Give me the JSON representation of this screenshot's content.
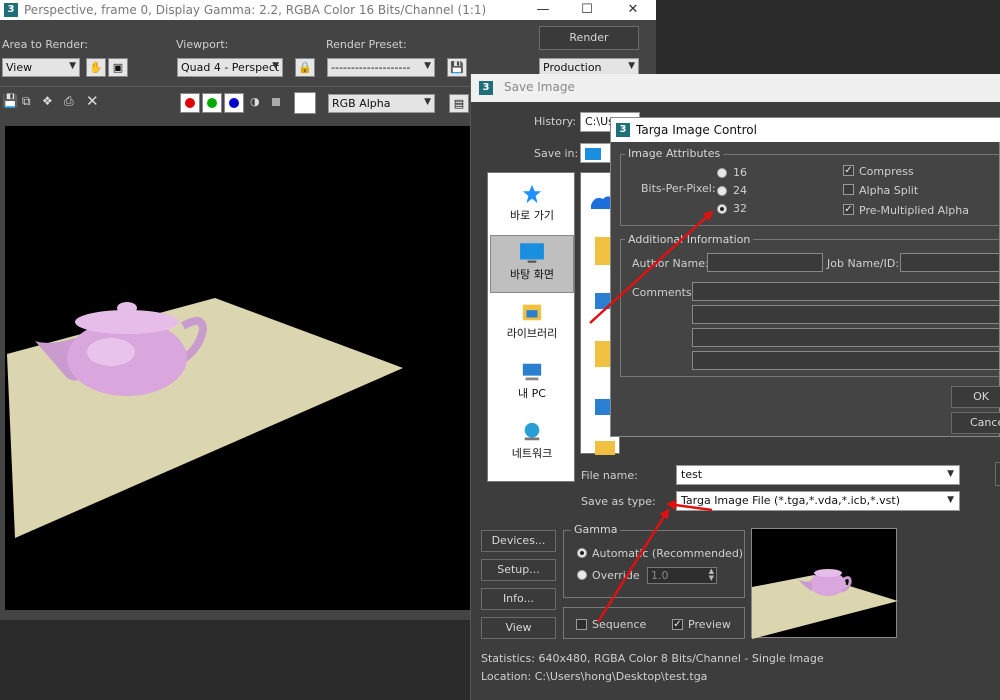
{
  "frame_window": {
    "title": "Perspective, frame 0, Display Gamma: 2.2, RGBA Color 16 Bits/Channel (1:1)",
    "area_label": "Area to Render:",
    "area_value": "View",
    "viewport_label": "Viewport:",
    "viewport_value": "Quad 4 - Perspect",
    "preset_label": "Render Preset:",
    "preset_value": "--------------------",
    "render_button": "Render",
    "production_value": "Production",
    "channel_value": "RGB Alpha"
  },
  "save_dialog": {
    "title": "Save Image",
    "history_label": "History:",
    "history_value": "C:\\Users\\hong\\Desktop",
    "savein_label": "Save in:",
    "sidebar": [
      {
        "label": "바로 가기",
        "icon": "star-icon"
      },
      {
        "label": "바탕 화면",
        "icon": "desktop-icon"
      },
      {
        "label": "라이브러리",
        "icon": "library-icon"
      },
      {
        "label": "내 PC",
        "icon": "pc-icon"
      },
      {
        "label": "네트워크",
        "icon": "network-icon"
      }
    ],
    "filename_label": "File name:",
    "filename_value": "test",
    "saveas_label": "Save as type:",
    "saveas_value": "Targa Image File (*.tga,*.vda,*.icb,*.vst)",
    "devices_button": "Devices...",
    "setup_button": "Setup...",
    "info_button": "Info...",
    "view_button": "View",
    "gamma_label": "Gamma",
    "gamma_auto": "Automatic (Recommended)",
    "gamma_override": "Override",
    "gamma_value": "1.0",
    "sequence_label": "Sequence",
    "preview_label": "Preview",
    "statistics": "Statistics:  640x480, RGBA Color 8 Bits/Channel - Single Image",
    "location": "Location:  C:\\Users\\hong\\Desktop\\test.tga"
  },
  "targa_dialog": {
    "title": "Targa Image Control",
    "attributes_label": "Image Attributes",
    "bpp_label": "Bits-Per-Pixel:",
    "bpp_options": [
      "16",
      "24",
      "32"
    ],
    "bpp_selected": "32",
    "compress_label": "Compress",
    "alpha_split_label": "Alpha Split",
    "premult_label": "Pre-Multiplied Alpha",
    "additional_label": "Additional Information",
    "author_label": "Author Name:",
    "job_label": "Job Name/ID:",
    "comments_label": "Comments:",
    "ok_button": "OK",
    "cancel_button": "Cancel"
  },
  "colors": {
    "annotation_arrow": "#e01010",
    "ground_plane": "#dcd6b0",
    "teapot": "#d9a7dd"
  }
}
